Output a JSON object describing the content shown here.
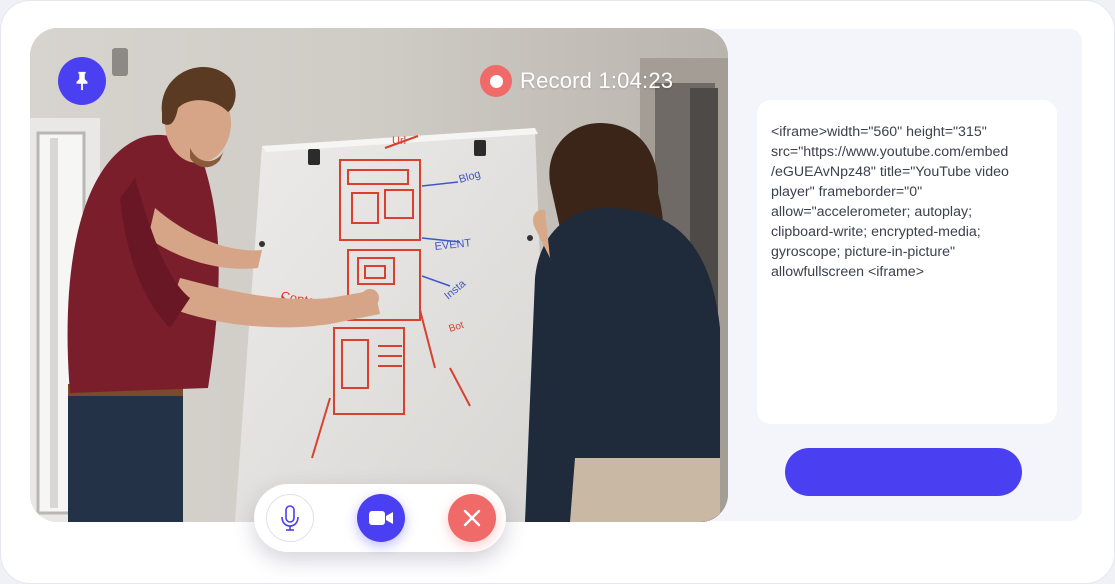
{
  "video": {
    "record_label": "Record",
    "record_time": "1:04:23"
  },
  "embed": {
    "code_lines": [
      "<iframe>width=\"560\" height=\"315\"",
      "src=\"https://www.youtube.com/embed",
      "/eGUEAvNpz48\" title=\"YouTube video",
      "player\" frameborder=\"0\"",
      "allow=\"accelerometer; autoplay;",
      "clipboard-write; encrypted-media;",
      "gyroscope; picture-in-picture\"",
      "allowfullscreen <iframe>"
    ],
    "button_label": ""
  },
  "controls": {
    "mic_icon": "microphone-icon",
    "camera_icon": "video-camera-icon",
    "end_icon": "close-icon",
    "pin_icon": "pin-icon"
  },
  "colors": {
    "accent": "#4b3ff2",
    "danger": "#f06a6a",
    "panel": "#f4f5fb"
  }
}
